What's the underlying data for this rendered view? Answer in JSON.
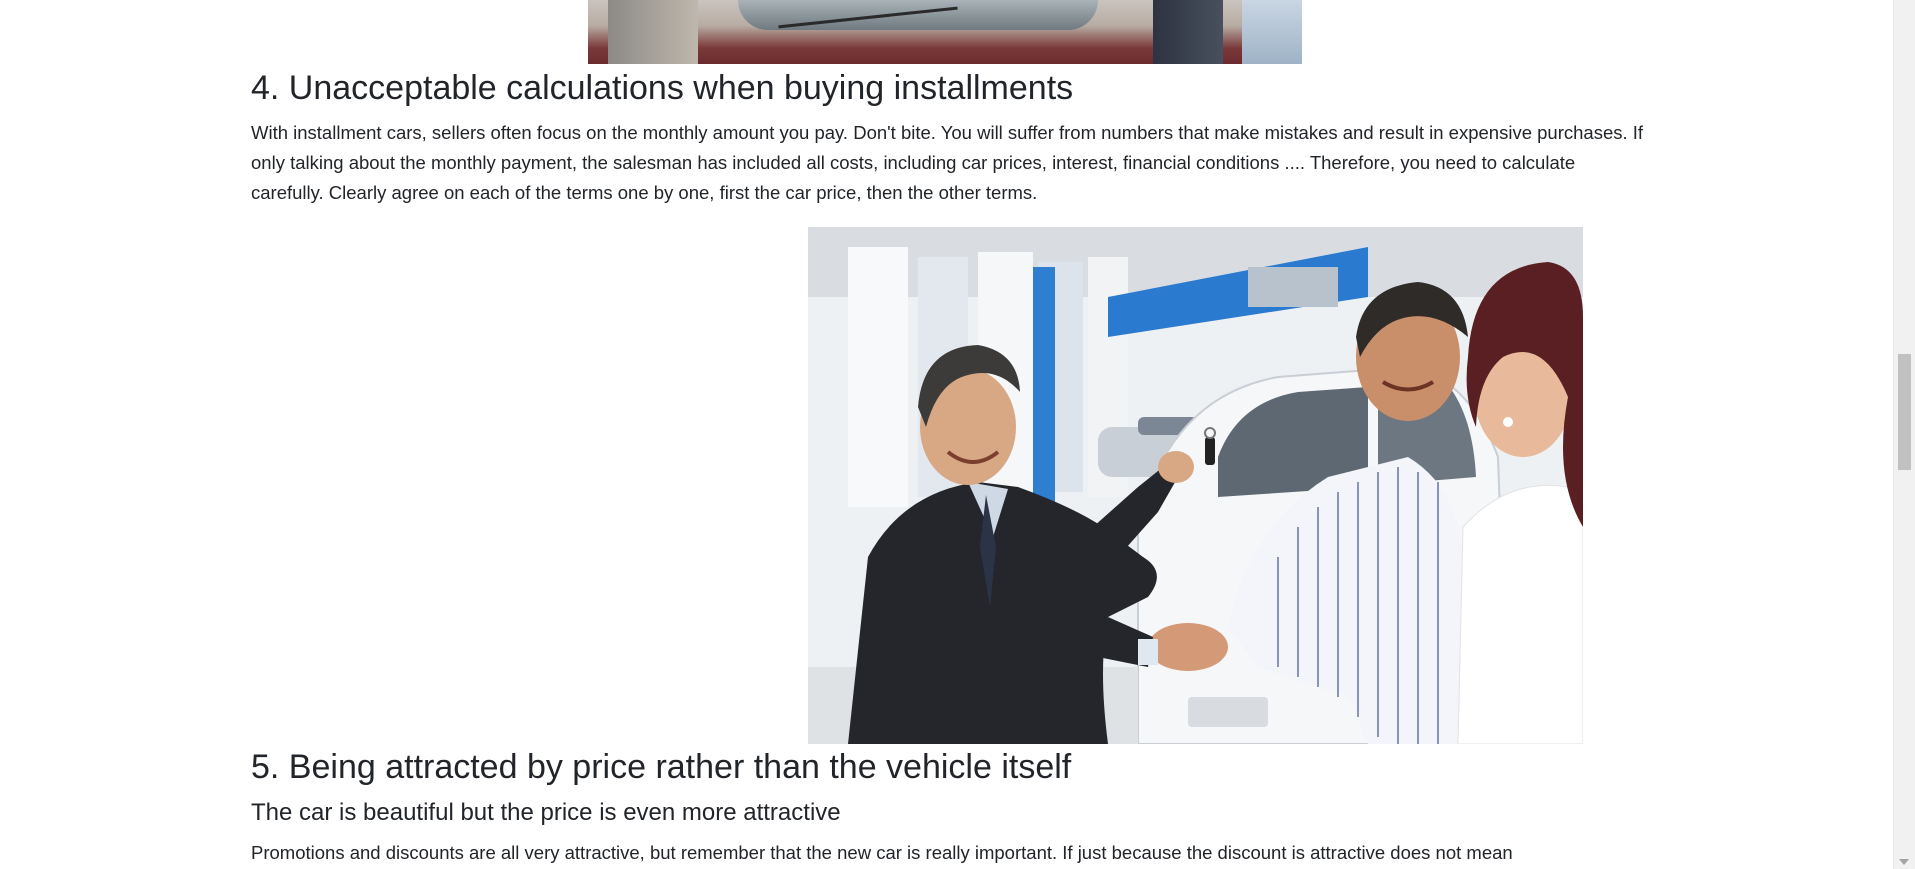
{
  "article": {
    "section4": {
      "heading": "4. Unacceptable calculations when buying installments",
      "paragraph": "With installment cars, sellers often focus on the monthly amount you pay. Don't bite. You will suffer from numbers that make mistakes and result in expensive purchases. If only talking about the monthly payment, the salesman has included all costs, including car prices, interest, financial conditions .... Therefore, you need to calculate carefully. Clearly agree on each of the terms one by one, first the car price, then the other terms."
    },
    "section5": {
      "heading": "5. Being attracted by price rather than the vehicle itself",
      "subheading": "The car is beautiful but the price is even more attractive",
      "paragraph": "Promotions and discounts are all very attractive, but remember that the new car is really important. If just because the discount is attractive does not mean"
    }
  },
  "images": {
    "top": "car-hood-photo",
    "main": "car-dealer-handshake-photo"
  },
  "colors": {
    "text": "#212529",
    "background": "#ffffff",
    "scrollbar_track": "#f1f1f1",
    "scrollbar_thumb": "#c1c1c1"
  }
}
